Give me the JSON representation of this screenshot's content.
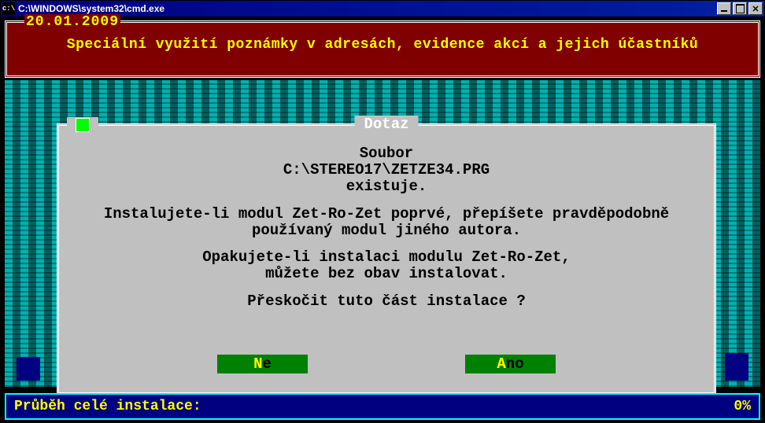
{
  "window": {
    "title": "C:\\WINDOWS\\system32\\cmd.exe",
    "icon_label": "cmd-icon"
  },
  "banner": {
    "date": "20.01.2009",
    "text": "Speciální využití poznámky v adresách, evidence akcí a jejich účastníků"
  },
  "dialog": {
    "title": "Dotaz",
    "line1": "Soubor",
    "line2": "C:\\STEREO17\\ZETZE34.PRG",
    "line3": "existuje.",
    "para2a": "Instalujete-li modul Zet-Ro-Zet poprvé, přepíšete pravděpodobně",
    "para2b": "používaný modul jiného autora.",
    "para3a": "Opakujete-li instalaci modulu Zet-Ro-Zet,",
    "para3b": "můžete bez obav instalovat.",
    "question": "Přeskočit tuto část instalace ?",
    "buttons": {
      "no": {
        "hotkey": "N",
        "rest": "e"
      },
      "yes": {
        "hotkey": "A",
        "rest": "no"
      }
    }
  },
  "progress": {
    "label": "Průběh celé instalace:",
    "percent": "0%"
  }
}
